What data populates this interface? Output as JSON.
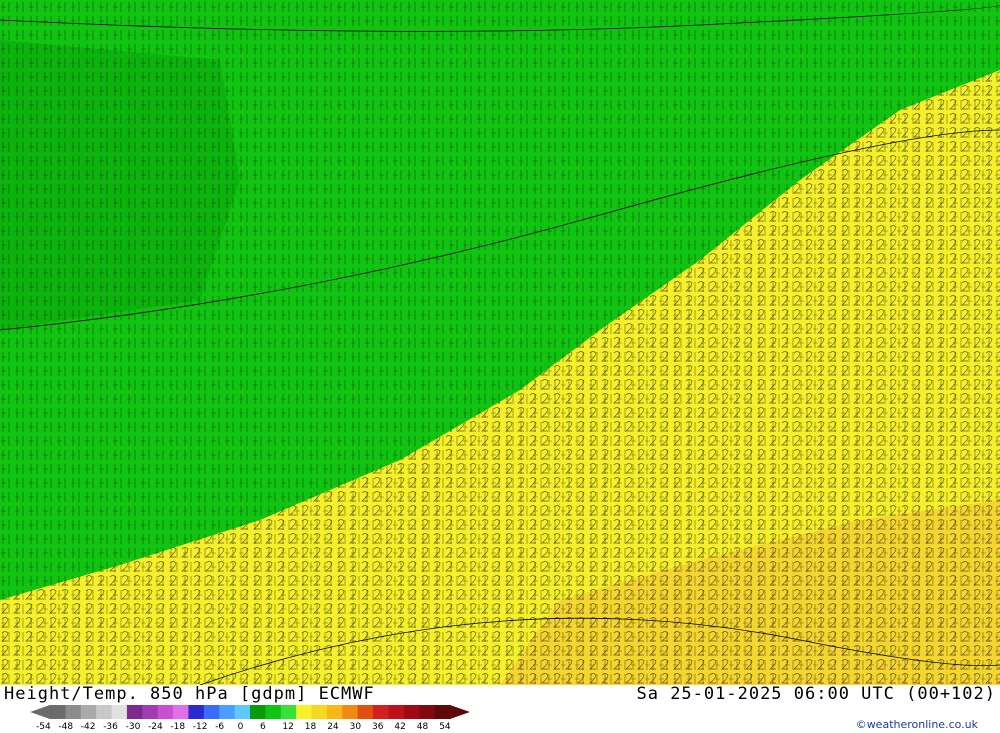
{
  "title_left": "Height/Temp. 850 hPa [gdpm] ECMWF",
  "title_right": "Sa 25-01-2025 06:00 UTC (00+102)",
  "credit": "©weatheronline.co.uk",
  "colors": {
    "cold_green": "#12c412",
    "dark_green": "#0aa80a",
    "warm_yellow": "#f5f02a",
    "warm_orange": "#f5cf30",
    "contour": "#000000"
  },
  "legend": {
    "ticks": [
      "-54",
      "-48",
      "-42",
      "-36",
      "-30",
      "-24",
      "-18",
      "-12",
      "-6",
      "0",
      "6",
      "12",
      "18",
      "24",
      "30",
      "36",
      "42",
      "48",
      "54"
    ],
    "colors": [
      "#6b6b6b",
      "#8c8c8c",
      "#aaaaaa",
      "#c8c8c8",
      "#e0e0e0",
      "#7a2a8a",
      "#a03cb0",
      "#c850d0",
      "#e070e8",
      "#2a2ad0",
      "#3a6aff",
      "#4aa0ff",
      "#60c8ff",
      "#0a9a0a",
      "#12c412",
      "#3ae03a",
      "#f5f02a",
      "#f5d820",
      "#f5b818",
      "#f08a10",
      "#e05010",
      "#d02020",
      "#c0101a",
      "#a00a14",
      "#800a10",
      "#600808"
    ]
  }
}
